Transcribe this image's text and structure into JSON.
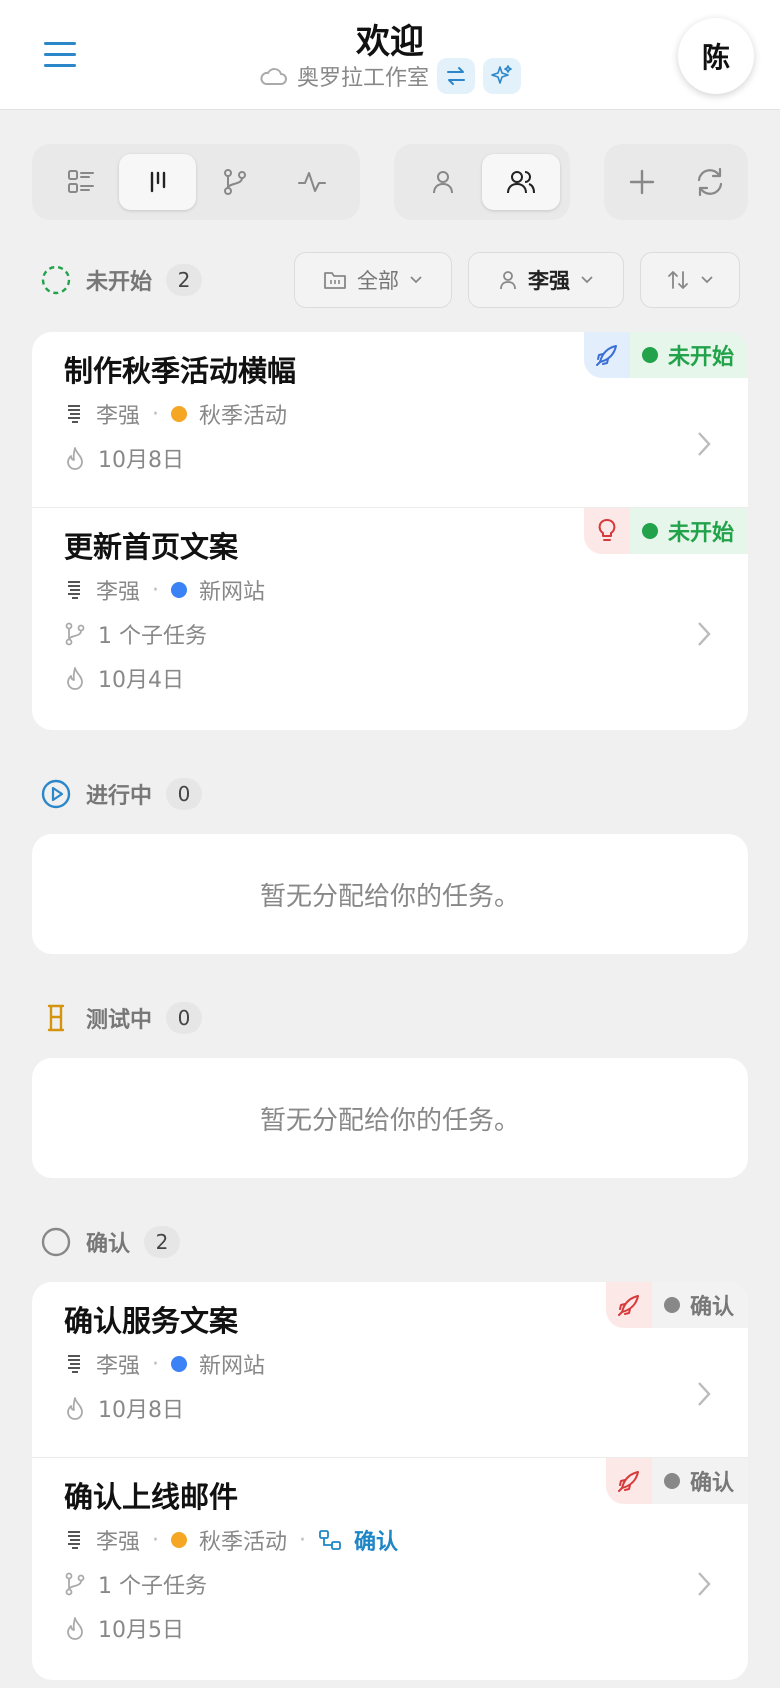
{
  "header": {
    "title": "欢迎",
    "studio": "奥罗拉工作室",
    "avatar_initial": "陈",
    "menu_icon": "hamburger-icon",
    "accent_color": "#2b87c9"
  },
  "toolbar": {
    "view_icons": [
      "list-view-icon",
      "board-view-icon",
      "branch-view-icon",
      "activity-view-icon"
    ],
    "active_view": "board-view-icon",
    "people_icons": [
      "single-user-icon",
      "multi-user-icon"
    ],
    "active_people": "multi-user-icon",
    "action_icons": [
      "plus-icon",
      "refresh-icon"
    ]
  },
  "filters": {
    "project": "全部",
    "assignee": "李强",
    "sort_icon": "sort-icon"
  },
  "sections": {
    "not_started": {
      "label": "未开始",
      "count": "2",
      "tasks": [
        {
          "title": "制作秋季活动横幅",
          "assignee": "李强",
          "project": "秋季活动",
          "project_color": "#f5a623",
          "date": "10月8日",
          "status": "未开始",
          "status_color": "#22a24a",
          "badge_icon": "rocket-icon"
        },
        {
          "title": "更新首页文案",
          "assignee": "李强",
          "project": "新网站",
          "project_color": "#3b82f6",
          "subtasks": "1 个子任务",
          "date": "10月4日",
          "status": "未开始",
          "status_color": "#22a24a",
          "badge_icon": "lightbulb-icon"
        }
      ]
    },
    "in_progress": {
      "label": "进行中",
      "count": "0",
      "empty": "暂无分配给你的任务。"
    },
    "testing": {
      "label": "测试中",
      "count": "0",
      "empty": "暂无分配给你的任务。"
    },
    "confirm": {
      "label": "确认",
      "count": "2",
      "tasks": [
        {
          "title": "确认服务文案",
          "assignee": "李强",
          "project": "新网站",
          "project_color": "#3b82f6",
          "date": "10月8日",
          "status": "确认",
          "status_color": "#888888",
          "badge_icon": "rocket-icon"
        },
        {
          "title": "确认上线邮件",
          "assignee": "李强",
          "project": "秋季活动",
          "project_color": "#f5a623",
          "dependency": "确认",
          "subtasks": "1 个子任务",
          "date": "10月5日",
          "status": "确认",
          "status_color": "#888888",
          "badge_icon": "rocket-icon"
        }
      ]
    }
  }
}
